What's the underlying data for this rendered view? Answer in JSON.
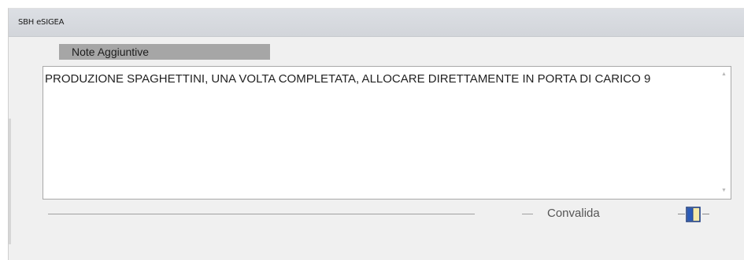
{
  "window": {
    "title": "SBH eSIGEA"
  },
  "notes": {
    "section_label": "Note Aggiuntive",
    "text": "PRODUZIONE SPAGHETTINI, UNA VOLTA COMPLETATA, ALLOCARE DIRETTAMENTE IN PORTA DI CARICO 9"
  },
  "footer": {
    "convalida_label": "Convalida"
  },
  "icons": {
    "scroll_up": "scroll-up-arrow-icon",
    "scroll_down": "scroll-down-arrow-icon",
    "confirm": "door-icon"
  },
  "colors": {
    "window_bg": "#f0f0f0",
    "titlebar_bg": "#d6d9de",
    "section_label_bg": "#a6a6a6",
    "door_accent": "#f5e9a8",
    "door_frame": "#1f3f86"
  }
}
